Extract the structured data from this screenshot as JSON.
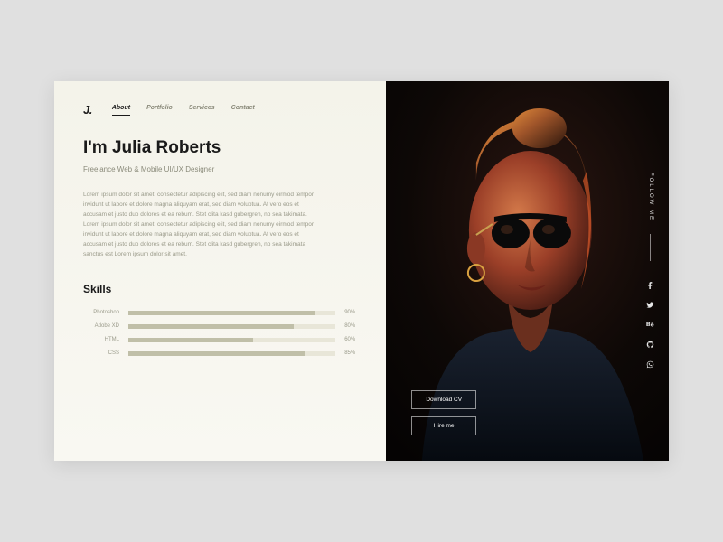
{
  "logo": "J.",
  "nav": {
    "items": [
      "About",
      "Portfolio",
      "Services",
      "Contact"
    ],
    "active": 0
  },
  "hero": {
    "title": "I'm Julia Roberts",
    "subtitle": "Freelance Web & Mobile UI/UX Designer",
    "body": "Lorem ipsum dolor sit amet, consectetur adipiscing elit, sed diam nonumy eirmod tempor invidunt ut labore et dolore magna aliquyam erat, sed diam voluptua. At vero eos et accusam et justo duo dolores et ea rebum. Stet clita kasd gubergren, no sea takimata. Lorem ipsum dolor sit amet, consectetur adipiscing elit, sed diam nonumy eirmod tempor invidunt ut labore et dolore magna aliquyam erat, sed diam voluptua. At vero eos et accusam et justo duo dolores et ea rebum. Stet clita kasd gubergren, no sea takimata sanctus est Lorem ipsum dolor sit amet."
  },
  "skills": {
    "title": "Skills",
    "items": [
      {
        "name": "Photoshop",
        "value": 90
      },
      {
        "name": "Adobe XD",
        "value": 80
      },
      {
        "name": "HTML",
        "value": 60
      },
      {
        "name": "CSS",
        "value": 85
      }
    ]
  },
  "cta": {
    "download": "Download CV",
    "hire": "Hire me"
  },
  "follow": {
    "label": "FOLLOW ME"
  }
}
